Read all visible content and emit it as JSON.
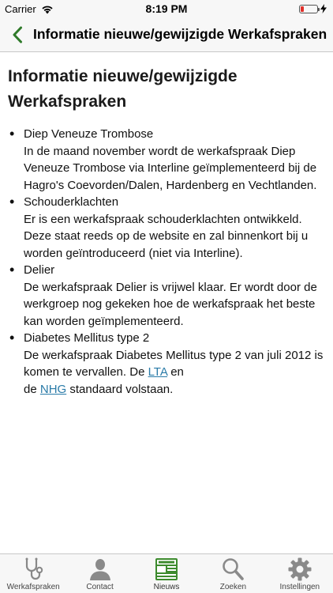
{
  "status": {
    "carrier": "Carrier",
    "time": "8:19 PM"
  },
  "nav": {
    "title": "Informatie nieuwe/gewijzigde Werkafspraken"
  },
  "page": {
    "title": "Informatie nieuwe/gewijzigde Werkafspraken",
    "topics": [
      {
        "title": "Diep Veneuze Trombose",
        "text": "In de maand november wordt de werkafspraak Diep Veneuze Trombose via Interline geïmplementeerd bij de Hagro's Coevorden/Dalen, Hardenberg en Vechtlanden."
      },
      {
        "title": "Schouderklachten",
        "text": "Er is een werkafspraak schouderklachten ontwikkeld. Deze staat reeds op de website en zal binnenkort bij u worden geïntroduceerd (niet via Interline)."
      },
      {
        "title": "Delier",
        "text": "De werkafspraak Delier is vrijwel klaar. Er wordt door de werkgroep nog gekeken hoe de werkafspraak het beste kan worden geïmplementeerd."
      },
      {
        "title": "Diabetes Mellitus type 2",
        "text_before": "De werkafspraak Diabetes Mellitus type 2 van juli 2012 is komen te vervallen. De ",
        "link1": "LTA",
        "text_middle_a": " en",
        "text_middle_b": "de ",
        "link2": "NHG",
        "text_after": " standaard volstaan."
      }
    ]
  },
  "tabs": [
    {
      "label": "Werkafspraken",
      "icon": "stethoscope-icon"
    },
    {
      "label": "Contact",
      "icon": "person-icon"
    },
    {
      "label": "Nieuws",
      "icon": "newspaper-icon"
    },
    {
      "label": "Zoeken",
      "icon": "search-icon"
    },
    {
      "label": "Instellingen",
      "icon": "gear-icon"
    }
  ],
  "colors": {
    "accent_green": "#2f7a2a",
    "link_blue": "#2a7ba8",
    "battery_red": "#e0302a"
  }
}
